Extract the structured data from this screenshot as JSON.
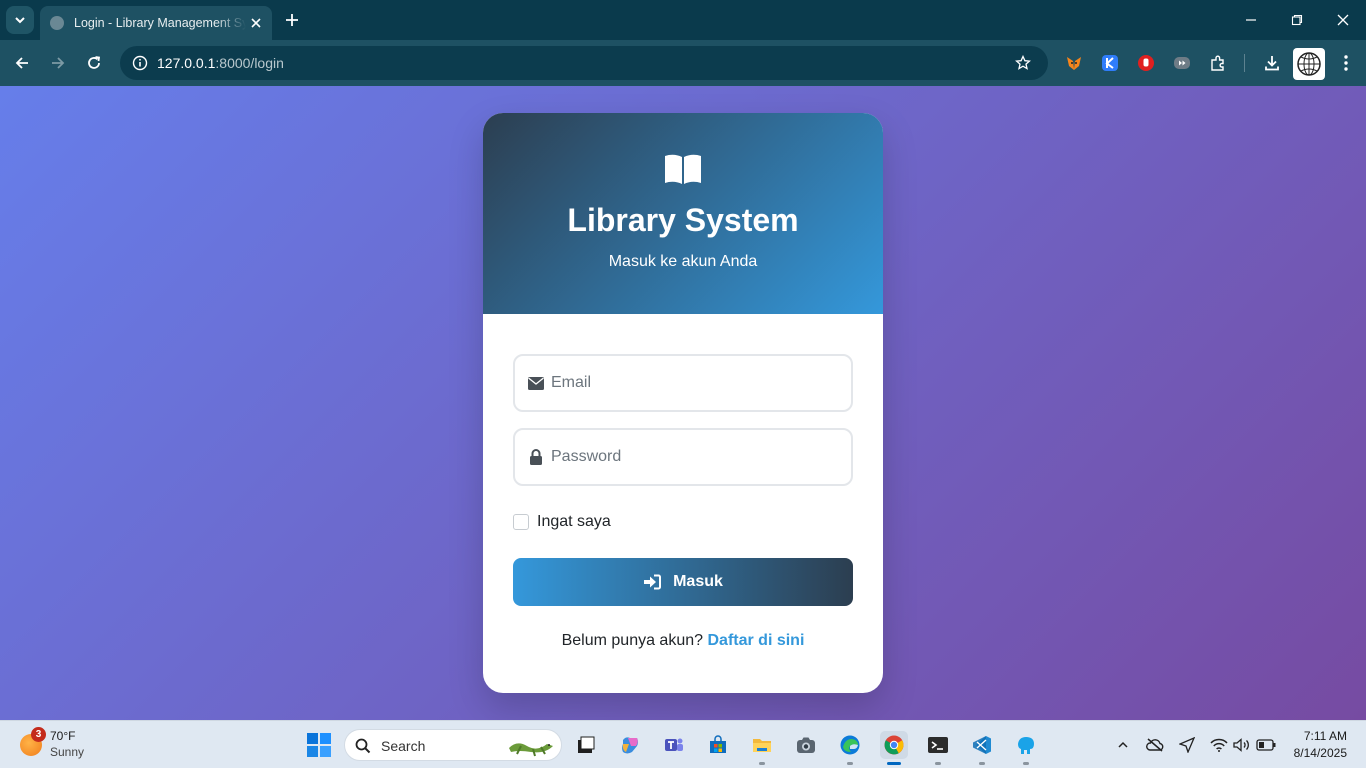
{
  "browser": {
    "tab_title": "Login - Library Management System",
    "url_host": "127.0.0.1",
    "url_path": ":8000/login"
  },
  "page": {
    "title": "Library System",
    "subtitle": "Masuk ke akun Anda",
    "email_placeholder": "Email",
    "password_placeholder": "Password",
    "remember_label": "Ingat saya",
    "submit_label": "Masuk",
    "register_prompt": "Belum punya akun?",
    "register_link": "Daftar di sini"
  },
  "taskbar": {
    "weather_badge": "3",
    "weather_temp": "70°F",
    "weather_condition": "Sunny",
    "search_label": "Search",
    "time": "7:11 AM",
    "date": "8/14/2025"
  },
  "colors": {
    "bg_gradient_start": "#667eea",
    "bg_gradient_end": "#764ba2",
    "header_gradient_start": "#2c3e50",
    "header_gradient_end": "#3498db",
    "accent": "#3498db"
  },
  "icons": {
    "header": "book-open-icon",
    "email": "envelope-icon",
    "password": "lock-icon",
    "submit": "sign-in-icon"
  }
}
